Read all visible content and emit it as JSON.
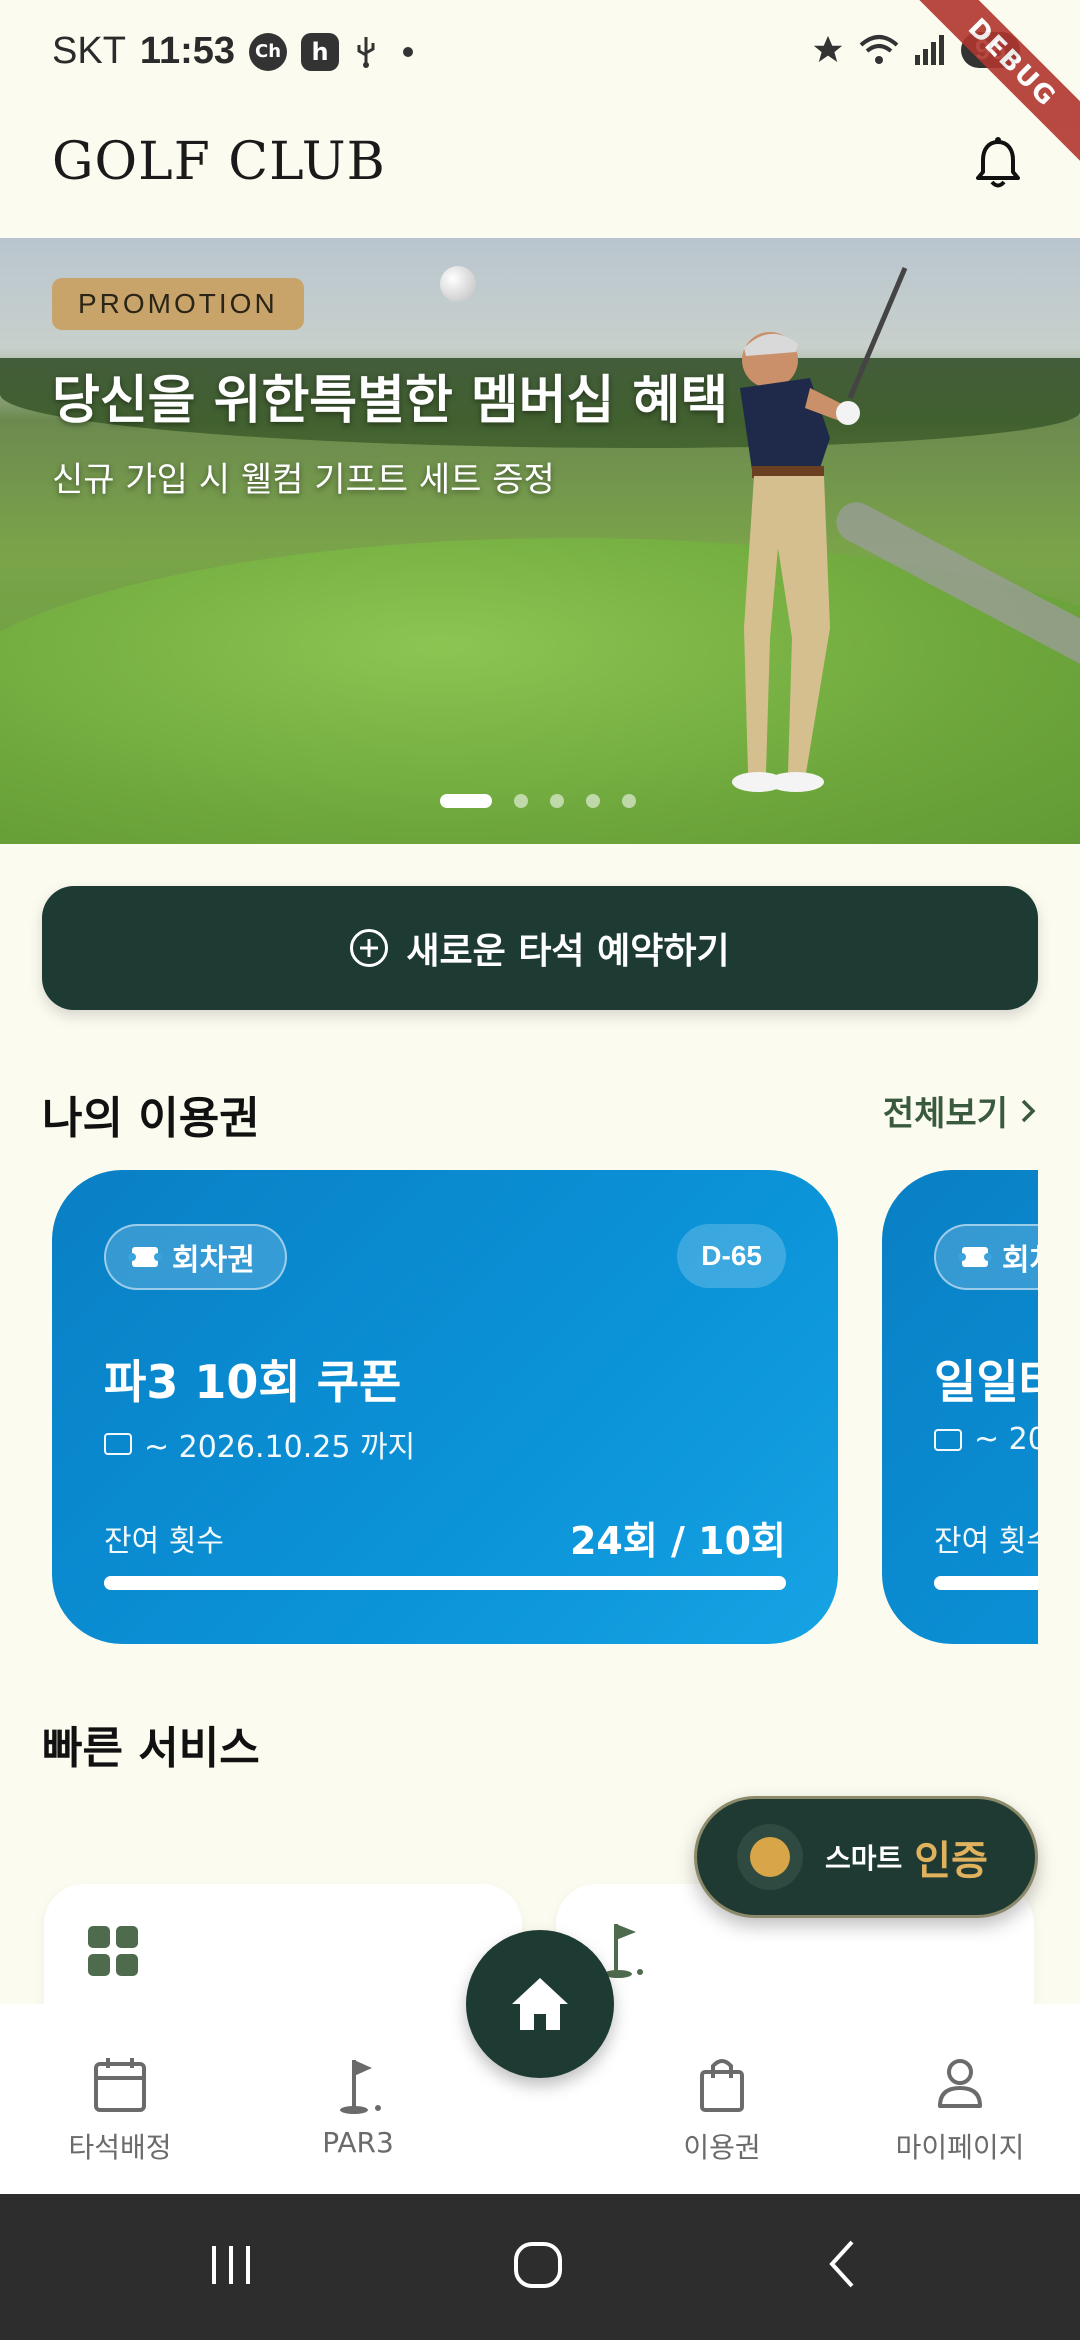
{
  "status_bar": {
    "carrier": "SKT",
    "time": "11:53",
    "battery": "96",
    "debug_label": "DEBUG",
    "badge_ch": "Ch",
    "badge_h": "h"
  },
  "header": {
    "brand": "GOLF CLUB",
    "icon": "bell-icon"
  },
  "banner": {
    "tag": "PROMOTION",
    "title": "당신을 위한특별한 멤버십 혜택",
    "subtitle": "신규 가입 시 웰컴 기프트 세트 증정",
    "slide_count": 5,
    "active_slide": 1
  },
  "reserve_button": {
    "label": "새로운 타석 예약하기",
    "icon": "plus-circle-icon"
  },
  "my_passes": {
    "title": "나의 이용권",
    "see_all": "전체보기",
    "cards": [
      {
        "type": "회차권",
        "dday": "D-65",
        "name": "파3 10회 쿠폰",
        "expiry": "~ 2026.10.25 까지",
        "remaining_label": "잔여 횟수",
        "remaining_value": "24회 / 10회",
        "progress": 1.0
      },
      {
        "type": "회차권",
        "name": "일일타",
        "expiry": "~ 20",
        "remaining_label": "잔여 횟수"
      }
    ]
  },
  "quick_services": {
    "title": "빠른 서비스"
  },
  "smart_auth": {
    "small_label": "스마트",
    "big_label": "인증",
    "accent": "#e0b25d"
  },
  "bottom_nav": {
    "items": [
      {
        "label": "타석배정",
        "icon": "calendar-icon"
      },
      {
        "label": "PAR3",
        "icon": "golf-flag-icon"
      },
      {
        "label": "이용권",
        "icon": "shopping-bag-icon"
      },
      {
        "label": "마이페이지",
        "icon": "person-icon"
      }
    ],
    "home_icon": "home-icon"
  },
  "colors": {
    "background": "#fbfbf0",
    "primary_dark_green": "#1d3a33",
    "card_blue": "#0b93d8",
    "promo_gold": "#c9a46a"
  }
}
